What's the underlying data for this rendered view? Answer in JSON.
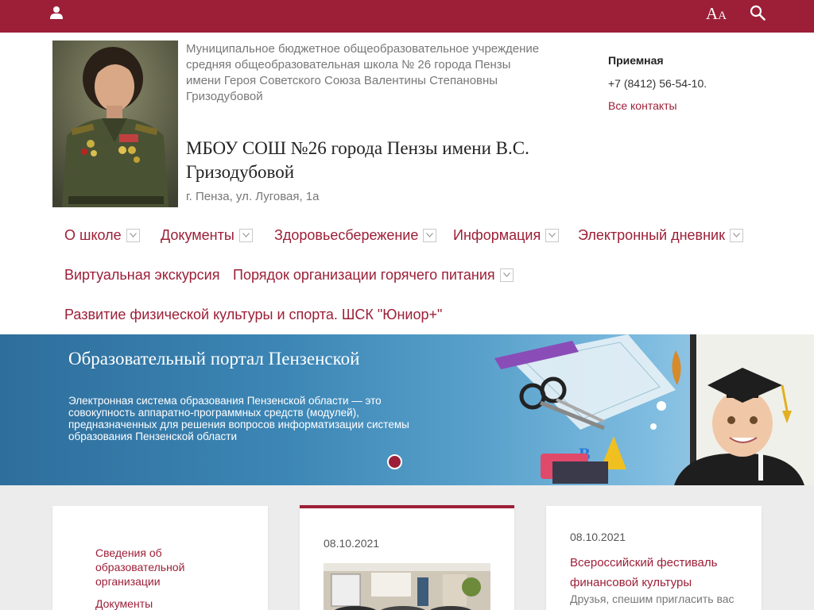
{
  "colors": {
    "accent": "#9c1f37",
    "banner_blue": "#3c86b5",
    "content_bg": "#ececec"
  },
  "topbar": {
    "user_icon": "user-icon",
    "font_size_big": "A",
    "font_size_small": "A",
    "search_icon": "search-icon"
  },
  "header": {
    "org_full_line1": "Муниципальное бюджетное общеобразовательное учреждение средняя общеобразовательная школа № 26 города Пензы",
    "org_full_line2": "имени Героя Советского Союза Валентины Степановны Гризодубовой",
    "org_short": "МБОУ СОШ №26 города Пензы имени В.С. Гризодубовой",
    "address": "г. Пенза, ул. Луговая, 1а",
    "contacts": {
      "label": "Приемная",
      "phone": "+7 (8412) 56-54-10.",
      "all_contacts": "Все контакты"
    }
  },
  "nav": {
    "items": [
      {
        "label": "О школе",
        "has_dropdown": true
      },
      {
        "label": "Документы",
        "has_dropdown": true
      },
      {
        "label": "Здоровьесбережение",
        "has_dropdown": true
      },
      {
        "label": "Информация",
        "has_dropdown": true
      },
      {
        "label": "Электронный дневник",
        "has_dropdown": true
      },
      {
        "label": "Виртуальная экскурсия",
        "has_dropdown": false
      },
      {
        "label": "Порядок организации горячего питания",
        "has_dropdown": true
      },
      {
        "label": "Развитие физической культуры и спорта. ШСК \"Юниор+\"",
        "has_dropdown": false
      }
    ]
  },
  "banner": {
    "title": "Образовательный портал Пензенской",
    "text": "Электронная система образования Пензенской области — это совокупность аппаратно-программных средств (модулей), предназначенных для решения вопросов информатизации системы образования Пензенской области"
  },
  "sidebar": {
    "links": [
      "Сведения об образовательной организации",
      "Документы"
    ]
  },
  "news": [
    {
      "date": "08.10.2021"
    },
    {
      "date": "08.10.2021",
      "title": "Всероссийский фестиваль финансовой культуры",
      "text": "Друзья, спешим пригласить вас"
    }
  ]
}
